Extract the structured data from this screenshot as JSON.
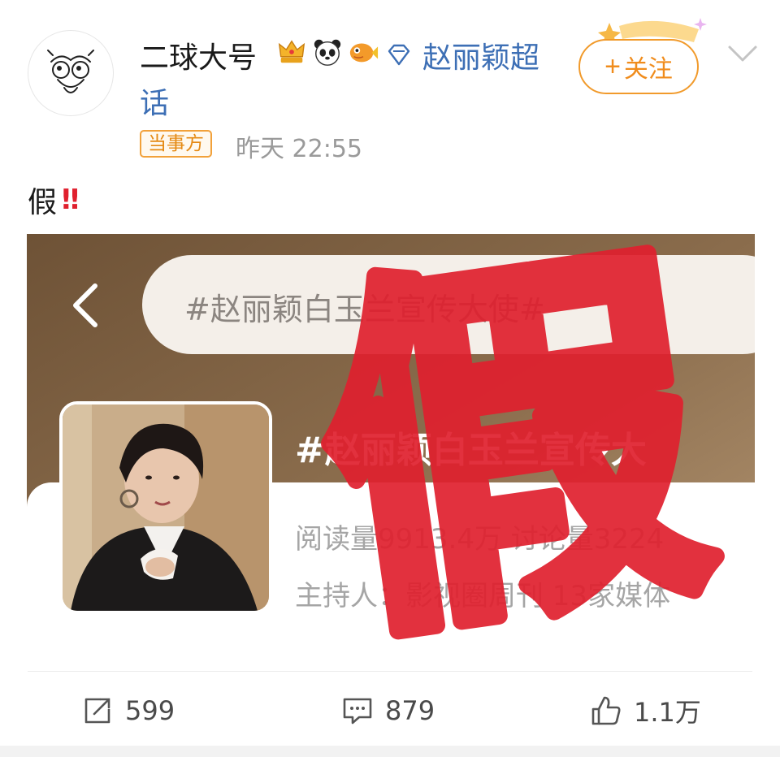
{
  "user": {
    "name": "二球大号",
    "badges": [
      "crown-badge-icon",
      "panda-badge-icon",
      "fish-badge-icon"
    ],
    "super_topic_line1": "赵丽颖超",
    "super_topic_line2": "话",
    "party_tag": "当事方",
    "time": "昨天 22:55"
  },
  "follow_button": {
    "plus": "+",
    "label": "关注"
  },
  "post": {
    "text": "假",
    "emoji": "‼"
  },
  "media": {
    "search_text": "#赵丽颖白玉兰宣传大使#",
    "topic_title": "#赵丽颖白玉兰宣传大",
    "stats": "阅读量9913.4万 讨论量3224",
    "host": "主持人：影视圈周刊 13家媒体",
    "stamp_text": "假"
  },
  "actions": {
    "share_count": "599",
    "comment_count": "879",
    "like_count": "1.1万"
  },
  "colors": {
    "link_blue": "#3d6fb5",
    "follow_orange": "#f08c1c",
    "stamp_red": "#e0202e",
    "media_brown": "#7a5d3d"
  }
}
